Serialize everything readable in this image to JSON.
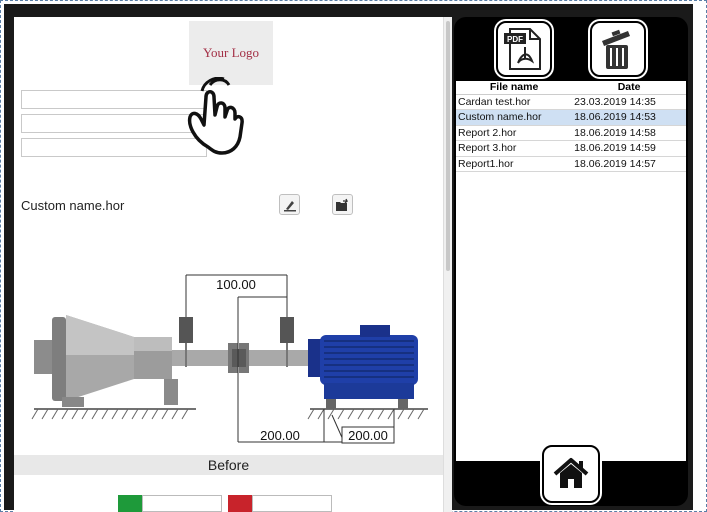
{
  "logo": {
    "text": "Your Logo"
  },
  "file": {
    "name": "Custom name.hor"
  },
  "diagram": {
    "top_distance": "100.00",
    "bottom_distance_left": "200.00",
    "bottom_distance_right": "200.00"
  },
  "section": {
    "label": "Before"
  },
  "files_panel": {
    "col_name": "File name",
    "col_date": "Date",
    "rows": [
      {
        "name": "Cardan test.hor",
        "date": "23.03.2019 14:35"
      },
      {
        "name": "Custom name.hor",
        "date": "18.06.2019 14:53"
      },
      {
        "name": "Report 2.hor",
        "date": "18.06.2019 14:58"
      },
      {
        "name": "Report 3.hor",
        "date": "18.06.2019 14:59"
      },
      {
        "name": "Report1.hor",
        "date": "18.06.2019 14:57"
      }
    ],
    "selected_index": 1
  },
  "icons": {
    "pdf": "pdf-icon",
    "trash": "trash-icon",
    "home": "home-icon",
    "edit": "edit-icon",
    "open": "folder-open-icon",
    "hand": "hand-pointer-icon"
  },
  "colors": {
    "motor": "#1f3fa8",
    "pump": "#9a9a9a",
    "selection": "#cfe0f3",
    "green": "#1e9a3a",
    "red": "#c8232b"
  }
}
